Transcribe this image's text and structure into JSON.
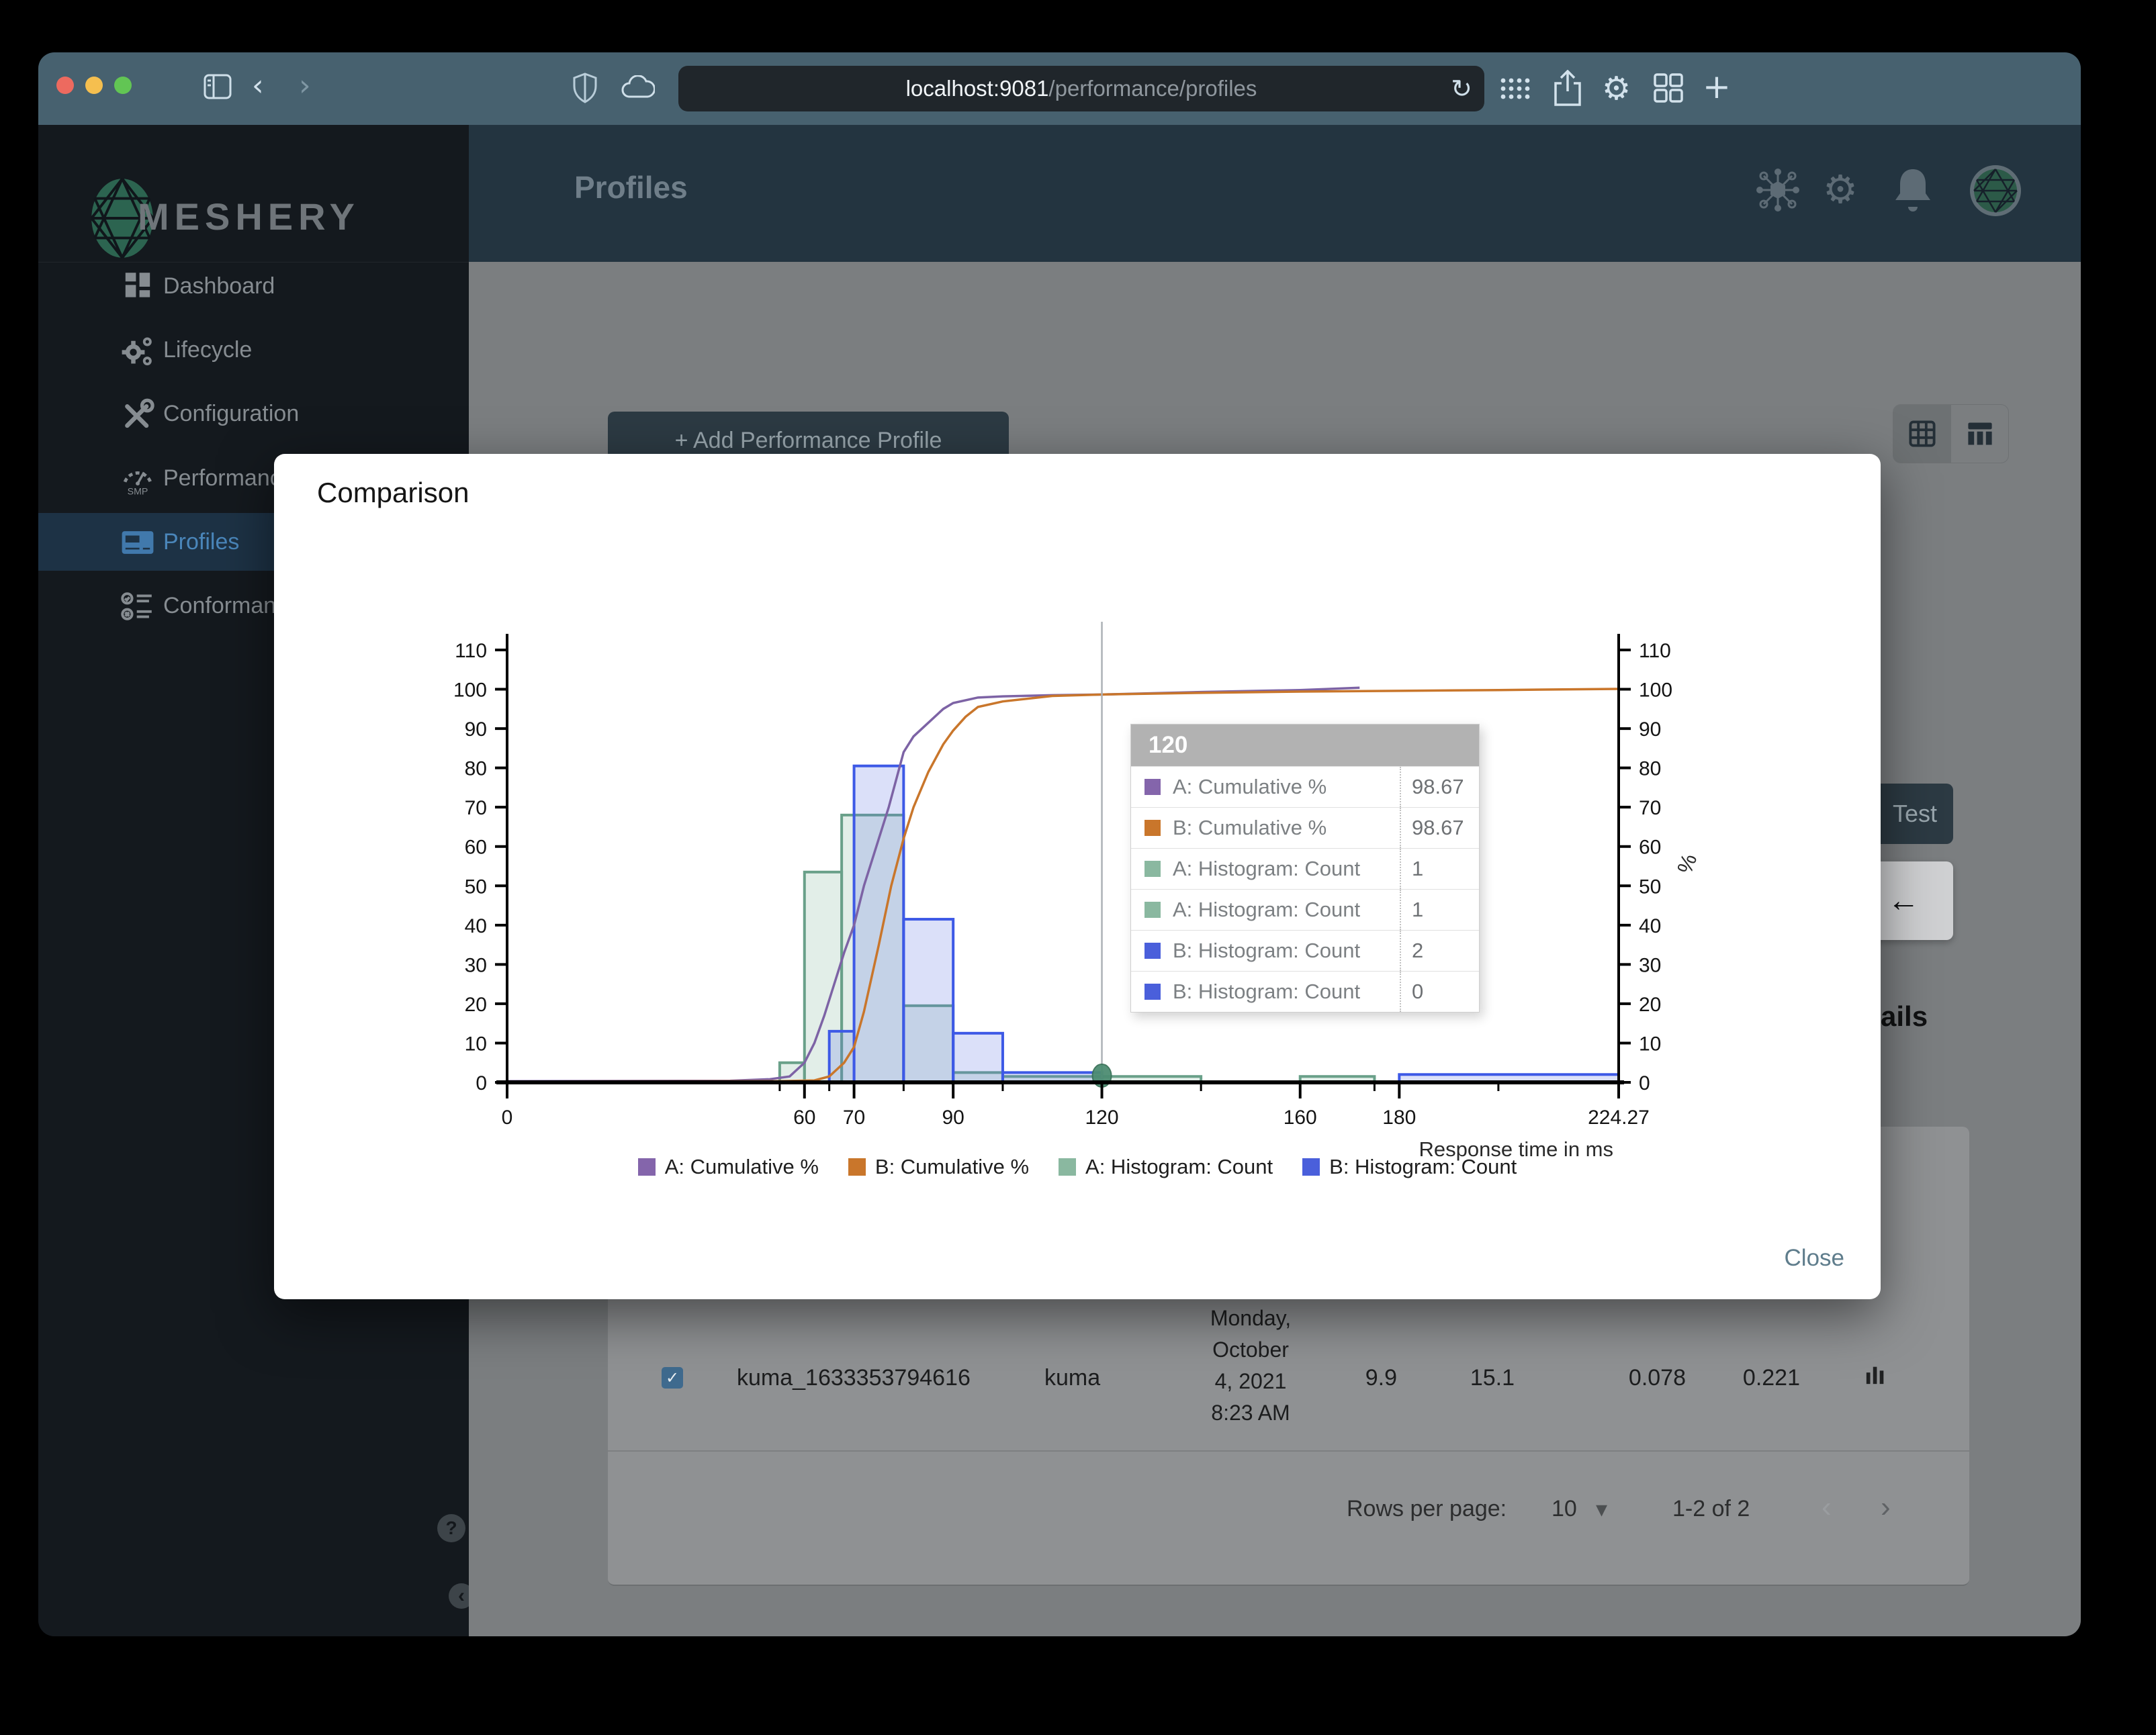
{
  "browser": {
    "url_host": "localhost:9081",
    "url_path": "/performance/profiles",
    "reload_glyph": "↻",
    "back_glyph": "‹",
    "forward_glyph": "›",
    "gear_glyph": "⚙",
    "plus_glyph": "+"
  },
  "header": {
    "title": "Profiles",
    "gear_glyph": "⚙"
  },
  "sidebar": {
    "brand": "MESHERY",
    "items": [
      {
        "label": "Dashboard"
      },
      {
        "label": "Lifecycle"
      },
      {
        "label": "Configuration"
      },
      {
        "label": "Performance"
      },
      {
        "label": "Profiles"
      },
      {
        "label": "Conformance"
      }
    ],
    "active_item": "Profiles",
    "help_glyph": "?",
    "collapse_glyph": "‹"
  },
  "content": {
    "add_button_label": "+ Add Performance Profile",
    "partial": {
      "test_label": "Test",
      "arrow": "←",
      "details_fragment": "ails"
    },
    "table": {
      "row": {
        "checked_glyph": "✓",
        "name": "kuma_1633353794616",
        "mesh": "kuma",
        "date_lines": [
          "Monday,",
          "October",
          "4, 2021",
          "8:23 AM"
        ],
        "qps": "9.9",
        "duration": "15.1",
        "p50": "0.078",
        "p99": "0.221"
      }
    },
    "pagination": {
      "label": "Rows per page:",
      "value": "10",
      "dropdown_glyph": "▾",
      "range": "1-2 of 2",
      "prev_glyph": "‹",
      "next_glyph": "›"
    }
  },
  "modal": {
    "title": "Comparison",
    "close_label": "Close"
  },
  "chart_data": {
    "type": "bar",
    "subtype": "histogram-with-cumulative-lines",
    "title": "Comparison",
    "xlabel": "Response time in ms",
    "ylabel_right": "%",
    "x_axis": {
      "max": 224.27,
      "ticks": [
        0,
        60,
        70,
        90,
        120,
        160,
        180,
        224.27
      ],
      "tick_labels": [
        "0",
        "60",
        "70",
        "90",
        "120",
        "160",
        "180",
        "224.27"
      ],
      "minor_ticks": [
        55,
        65,
        80,
        100,
        140,
        175,
        200
      ]
    },
    "y_axis": {
      "min": 0,
      "max": 110,
      "tick_step": 10
    },
    "series": [
      {
        "name": "A: Histogram: Count",
        "type": "bars",
        "stroke": "#69a089",
        "fill": "rgba(138,186,163,0.25)",
        "bars": [
          [
            55,
            60,
            5
          ],
          [
            60,
            67.5,
            53.5
          ],
          [
            67.5,
            80,
            68
          ],
          [
            80,
            90,
            19.5
          ],
          [
            90,
            100,
            2.5
          ],
          [
            100,
            120,
            1.5
          ],
          [
            120,
            140,
            1.5
          ],
          [
            160,
            175,
            1.5
          ]
        ]
      },
      {
        "name": "B: Histogram: Count",
        "type": "bars",
        "stroke": "#3d59e6",
        "fill": "rgba(92,112,226,0.22)",
        "bars": [
          [
            65,
            70,
            13
          ],
          [
            70,
            80,
            80.5
          ],
          [
            80,
            90,
            41.5
          ],
          [
            90,
            100,
            12.5
          ],
          [
            100,
            120,
            2.5
          ],
          [
            180,
            224.27,
            2
          ]
        ]
      },
      {
        "name": "A: Cumulative %",
        "type": "line",
        "color": "#7d63a5",
        "points": [
          [
            0,
            0.3
          ],
          [
            45,
            0.4
          ],
          [
            53,
            0.8
          ],
          [
            57,
            1.5
          ],
          [
            60,
            5
          ],
          [
            62,
            10
          ],
          [
            64,
            17
          ],
          [
            66,
            25
          ],
          [
            68,
            33
          ],
          [
            70,
            40
          ],
          [
            72,
            50
          ],
          [
            75,
            62
          ],
          [
            77,
            70
          ],
          [
            80,
            84
          ],
          [
            82,
            88
          ],
          [
            85,
            91.5
          ],
          [
            88,
            95
          ],
          [
            90,
            96.5
          ],
          [
            95,
            97.9
          ],
          [
            100,
            98.2
          ],
          [
            110,
            98.5
          ],
          [
            120,
            98.67
          ],
          [
            140,
            99.3
          ],
          [
            160,
            99.8
          ],
          [
            172,
            100.4
          ]
        ]
      },
      {
        "name": "B: Cumulative %",
        "type": "line",
        "color": "#c9762b",
        "points": [
          [
            0,
            0.2
          ],
          [
            55,
            0.3
          ],
          [
            62,
            0.5
          ],
          [
            65,
            1.5
          ],
          [
            68,
            5
          ],
          [
            70,
            9
          ],
          [
            72,
            18
          ],
          [
            75,
            35
          ],
          [
            77.5,
            50
          ],
          [
            80,
            62
          ],
          [
            82,
            70
          ],
          [
            85,
            79
          ],
          [
            88,
            86
          ],
          [
            90,
            89.5
          ],
          [
            92.5,
            93
          ],
          [
            95,
            95.5
          ],
          [
            100,
            96.9
          ],
          [
            110,
            98.3
          ],
          [
            120,
            98.67
          ],
          [
            140,
            99.1
          ],
          [
            160,
            99.4
          ],
          [
            180,
            99.6
          ],
          [
            200,
            99.8
          ],
          [
            224.27,
            100.1
          ]
        ]
      }
    ],
    "crosshair": {
      "x": 120,
      "dot_fill": "#4d8d72",
      "dot_stroke": "#3a7259"
    },
    "tooltip": {
      "title": "120",
      "rows": [
        {
          "color": "#8465ab",
          "label": "A: Cumulative %",
          "value": "98.67"
        },
        {
          "color": "#c9762b",
          "label": "B: Cumulative %",
          "value": "98.67"
        },
        {
          "color": "#8ab8a0",
          "label": "A: Histogram: Count",
          "value": "1"
        },
        {
          "color": "#8ab8a0",
          "label": "A: Histogram: Count",
          "value": "1"
        },
        {
          "color": "#4a5fdb",
          "label": "B: Histogram: Count",
          "value": "2"
        },
        {
          "color": "#4a5fdb",
          "label": "B: Histogram: Count",
          "value": "0"
        }
      ]
    },
    "legend": [
      {
        "label": "A: Cumulative %",
        "color": "#8465ab"
      },
      {
        "label": "B: Cumulative %",
        "color": "#c9762b"
      },
      {
        "label": "A: Histogram: Count",
        "color": "#8ab8a0"
      },
      {
        "label": "B: Histogram: Count",
        "color": "#4a5fdb"
      }
    ],
    "legend_position": "bottom-center",
    "grid": false
  },
  "colors": {
    "chrome": "#47616f",
    "header_bg": "#233440",
    "sidebar_bg": "#14191e",
    "active_nav_bg": "#1d3245",
    "active_nav_text": "#4a86ba",
    "content_dimmed_bg": "#7b7e80",
    "modal_bg": "#ffffff",
    "accent_close": "#5f7d8c"
  }
}
